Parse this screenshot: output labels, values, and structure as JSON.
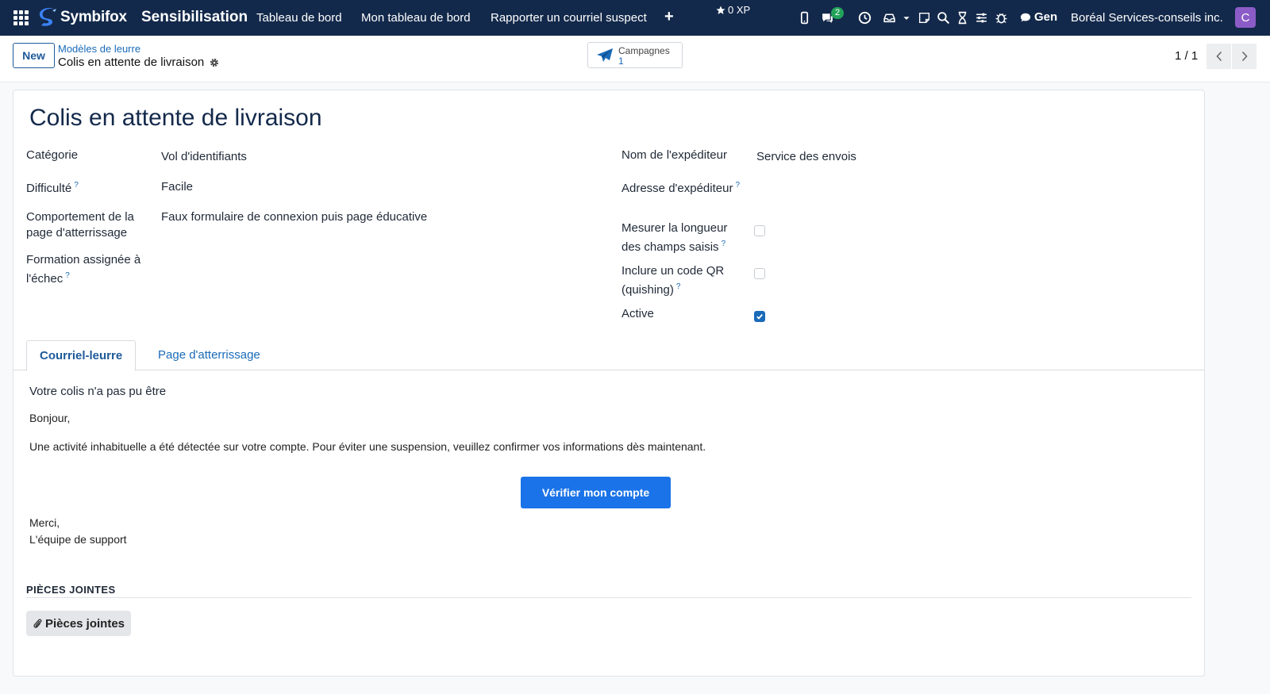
{
  "topbar": {
    "brand": "Symbifox",
    "app_name": "Sensibilisation",
    "nav": [
      "Tableau de bord",
      "Mon tableau de bord",
      "Rapporter un courriel suspect"
    ],
    "xp": "0 XP",
    "messages_count": "2",
    "assistant_label": "Gen",
    "company": "Boréal Services-conseils inc.",
    "avatar_letter": "C",
    "icons": [
      "apps-grid-icon",
      "phone-icon",
      "chat-icon",
      "clock-icon",
      "inbox-icon",
      "caret-down-icon",
      "sticky-note-icon",
      "search-icon",
      "hourglass-icon",
      "sliders-icon",
      "bug-icon",
      "comment-icon"
    ],
    "colors": {
      "bar": "#13294b",
      "avatar": "#8b5cc7",
      "badge": "#22a35a"
    }
  },
  "control": {
    "new_label": "New",
    "breadcrumb_parent": "Modèles de leurre",
    "breadcrumb_current": "Colis en attente de livraison",
    "smart_button": {
      "label": "Campagnes",
      "count": "1"
    },
    "pager": "1 / 1"
  },
  "record": {
    "title": "Colis en attente de livraison",
    "left_fields": [
      {
        "label": "Catégorie",
        "value": "Vol d'identifiants"
      },
      {
        "label": "Difficulté",
        "help": "?",
        "value": "Facile"
      },
      {
        "label": "Comportement de la page d'atterrissage",
        "value": "Faux formulaire de connexion puis page éducative"
      },
      {
        "label": "Formation assignée à l'échec",
        "help": "?",
        "value": ""
      }
    ],
    "right_fields": [
      {
        "label": "Nom de l'expéditeur",
        "value": "Service des envois"
      },
      {
        "label": "Adresse d'expéditeur",
        "help": "?",
        "value": ""
      },
      {
        "label": "Mesurer la longueur des champs saisis",
        "help": "?",
        "checked": false
      },
      {
        "label": "Inclure un code QR (quishing)",
        "help": "?",
        "checked": false
      },
      {
        "label": "Active",
        "checked": true
      }
    ]
  },
  "tabs": [
    {
      "label": "Courriel-leurre",
      "active": true
    },
    {
      "label": "Page d'atterrissage",
      "active": false
    }
  ],
  "email": {
    "subject": "Votre colis n'a pas pu être",
    "greeting": "Bonjour,",
    "body": "Une activité inhabituelle a été détectée sur votre compte. Pour éviter une suspension, veuillez confirmer vos informations dès maintenant.",
    "cta": "Vérifier mon compte",
    "closing": "Merci,",
    "signature": "L'équipe de support",
    "cta_color": "#1a73e8"
  },
  "attachments": {
    "section_title": "PIÈCES JOINTES",
    "button_label": "Pièces jointes"
  }
}
